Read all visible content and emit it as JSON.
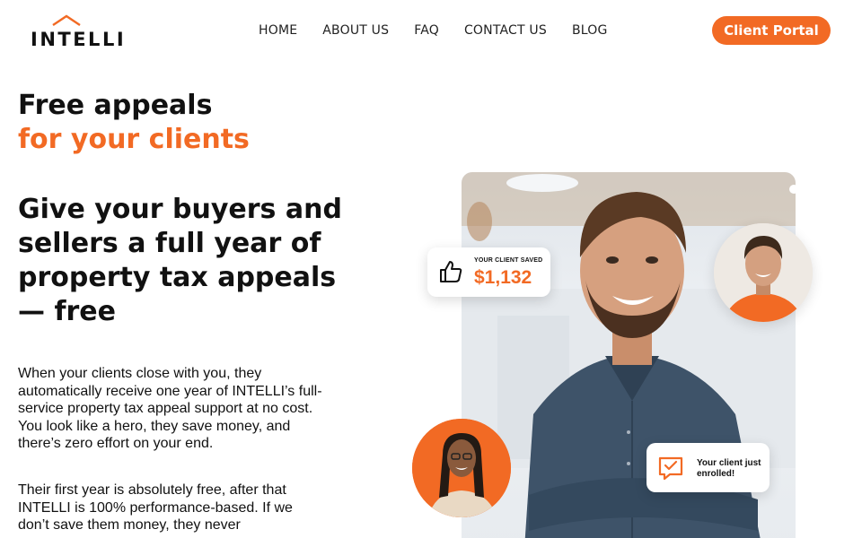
{
  "brand": {
    "logo_text": "INTELLI",
    "accent_color": "#f26a24"
  },
  "nav": {
    "items": [
      {
        "label": "HOME"
      },
      {
        "label": "ABOUT US"
      },
      {
        "label": "FAQ"
      },
      {
        "label": "CONTACT US"
      },
      {
        "label": "BLOG"
      }
    ],
    "portal_button": "Client Portal"
  },
  "hero": {
    "eyebrow_line1": "Free appeals",
    "eyebrow_line2": "for your clients",
    "headline": "Give your buyers and sellers a full year of property tax appeals — free",
    "paragraph1": "When your clients close with you, they automatically receive one year of INTELLI’s full-service property tax appeal support at no cost. You look like a hero, they save money, and there’s zero effort on your end.",
    "paragraph2": "Their first year is absolutely free, after that INTELLI is 100% performance-based. If we don’t save them money, they never"
  },
  "cards": {
    "saved_label": "YOUR CLIENT SAVED",
    "saved_amount": "$1,132",
    "saved_icon": "thumbs-up-icon",
    "enrolled_text": "Your client just enrolled!",
    "enrolled_icon": "checkbox-message-icon"
  }
}
